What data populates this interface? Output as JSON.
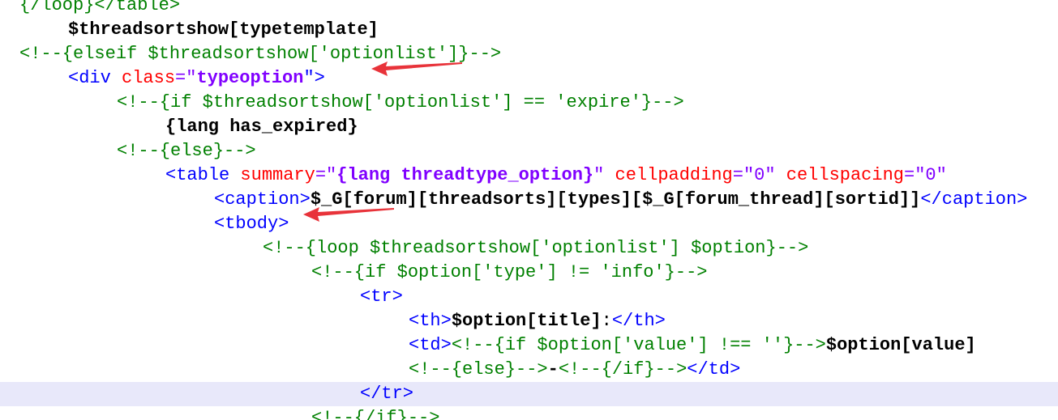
{
  "lines": [
    {
      "indent": 0,
      "tokens": [
        {
          "t": "{/loop}</table>",
          "k": "comment"
        }
      ]
    },
    {
      "indent": 1,
      "tokens": [
        {
          "t": "$threadsortshow[typetemplate]",
          "k": "bold"
        }
      ]
    },
    {
      "indent": 0,
      "tokens": [
        {
          "t": "<!--{elseif $threadsortshow['optionlist']}-->",
          "k": "comment"
        }
      ]
    },
    {
      "indent": 1,
      "tokens": [
        {
          "t": "<div ",
          "k": "tag"
        },
        {
          "t": "class",
          "k": "attr"
        },
        {
          "t": "=\"",
          "k": "str"
        },
        {
          "t": "typeoption",
          "k": "strbold"
        },
        {
          "t": "\">",
          "k": "tag"
        }
      ]
    },
    {
      "indent": 2,
      "tokens": [
        {
          "t": "<!--{if $threadsortshow['optionlist'] == 'expire'}-->",
          "k": "comment"
        }
      ]
    },
    {
      "indent": 3,
      "tokens": [
        {
          "t": "{lang has_expired}",
          "k": "bold"
        }
      ]
    },
    {
      "indent": 2,
      "tokens": [
        {
          "t": "<!--{else}-->",
          "k": "comment"
        }
      ]
    },
    {
      "indent": 3,
      "tokens": [
        {
          "t": "<table ",
          "k": "tag"
        },
        {
          "t": "summary",
          "k": "attr"
        },
        {
          "t": "=\"",
          "k": "str"
        },
        {
          "t": "{lang threadtype_option}",
          "k": "strbold"
        },
        {
          "t": "\" ",
          "k": "str"
        },
        {
          "t": "cellpadding",
          "k": "attr"
        },
        {
          "t": "=\"0\" ",
          "k": "str"
        },
        {
          "t": "cellspacing",
          "k": "attr"
        },
        {
          "t": "=\"0\"",
          "k": "str"
        }
      ]
    },
    {
      "indent": 4,
      "tokens": [
        {
          "t": "<caption>",
          "k": "tag"
        },
        {
          "t": "$_G[forum][threadsorts][types][$_G[forum_thread][sortid]]",
          "k": "bold"
        },
        {
          "t": "</caption>",
          "k": "tag"
        }
      ]
    },
    {
      "indent": 4,
      "tokens": [
        {
          "t": "<tbody>",
          "k": "tag"
        }
      ]
    },
    {
      "indent": 5,
      "tokens": [
        {
          "t": "<!--{loop $threadsortshow['optionlist'] $option}-->",
          "k": "comment"
        }
      ]
    },
    {
      "indent": 6,
      "tokens": [
        {
          "t": "<!--{if $option['type'] != 'info'}-->",
          "k": "comment"
        }
      ]
    },
    {
      "indent": 7,
      "tokens": [
        {
          "t": "<tr>",
          "k": "tag"
        }
      ]
    },
    {
      "indent": 8,
      "tokens": [
        {
          "t": "<th>",
          "k": "tag"
        },
        {
          "t": "$option[title]",
          "k": "bold"
        },
        {
          "t": ":",
          "k": "plain"
        },
        {
          "t": "</th>",
          "k": "tag"
        }
      ]
    },
    {
      "indent": 8,
      "tokens": [
        {
          "t": "<td>",
          "k": "tag"
        },
        {
          "t": "<!--{if $option['value'] !== ''}-->",
          "k": "comment"
        },
        {
          "t": "$option[value]",
          "k": "bold"
        }
      ]
    },
    {
      "indent": 8,
      "tokens": [
        {
          "t": "<!--{else}-->",
          "k": "comment"
        },
        {
          "t": "-",
          "k": "bold"
        },
        {
          "t": "<!--{/if}-->",
          "k": "comment"
        },
        {
          "t": "</td>",
          "k": "tag"
        }
      ]
    },
    {
      "indent": 7,
      "current": true,
      "tokens": [
        {
          "t": "</tr>",
          "k": "tag"
        }
      ]
    },
    {
      "indent": 6,
      "tokens": [
        {
          "t": "<!--{/if}-->",
          "k": "comment"
        }
      ]
    }
  ],
  "annotations": [
    {
      "name": "arrow-to-typeoption",
      "line": 3,
      "color": "#e8333a"
    },
    {
      "name": "arrow-to-tbody",
      "line": 9,
      "color": "#e8333a"
    }
  ]
}
